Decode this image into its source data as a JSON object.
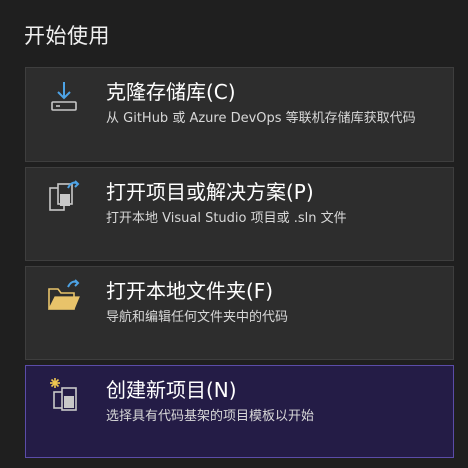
{
  "section": {
    "title": "开始使用"
  },
  "actions": [
    {
      "title": "克隆存储库(C)",
      "description": "从 GitHub 或 Azure DevOps 等联机存储库获取代码",
      "icon": "download-clone-icon"
    },
    {
      "title": "打开项目或解决方案(P)",
      "description": "打开本地 Visual Studio 项目或 .sln 文件",
      "icon": "open-project-icon"
    },
    {
      "title": "打开本地文件夹(F)",
      "description": "导航和编辑任何文件夹中的代码",
      "icon": "open-folder-icon"
    },
    {
      "title": "创建新项目(N)",
      "description": "选择具有代码基架的项目模板以开始",
      "icon": "new-project-icon"
    }
  ],
  "colors": {
    "background": "#1f1f1f",
    "card": "#2d2d2d",
    "card_selected": "#241c46",
    "card_selected_border": "#5b4ca8",
    "accent_blue": "#4da3e6",
    "folder_yellow": "#e8c36a",
    "sparkle": "#f0c850"
  }
}
